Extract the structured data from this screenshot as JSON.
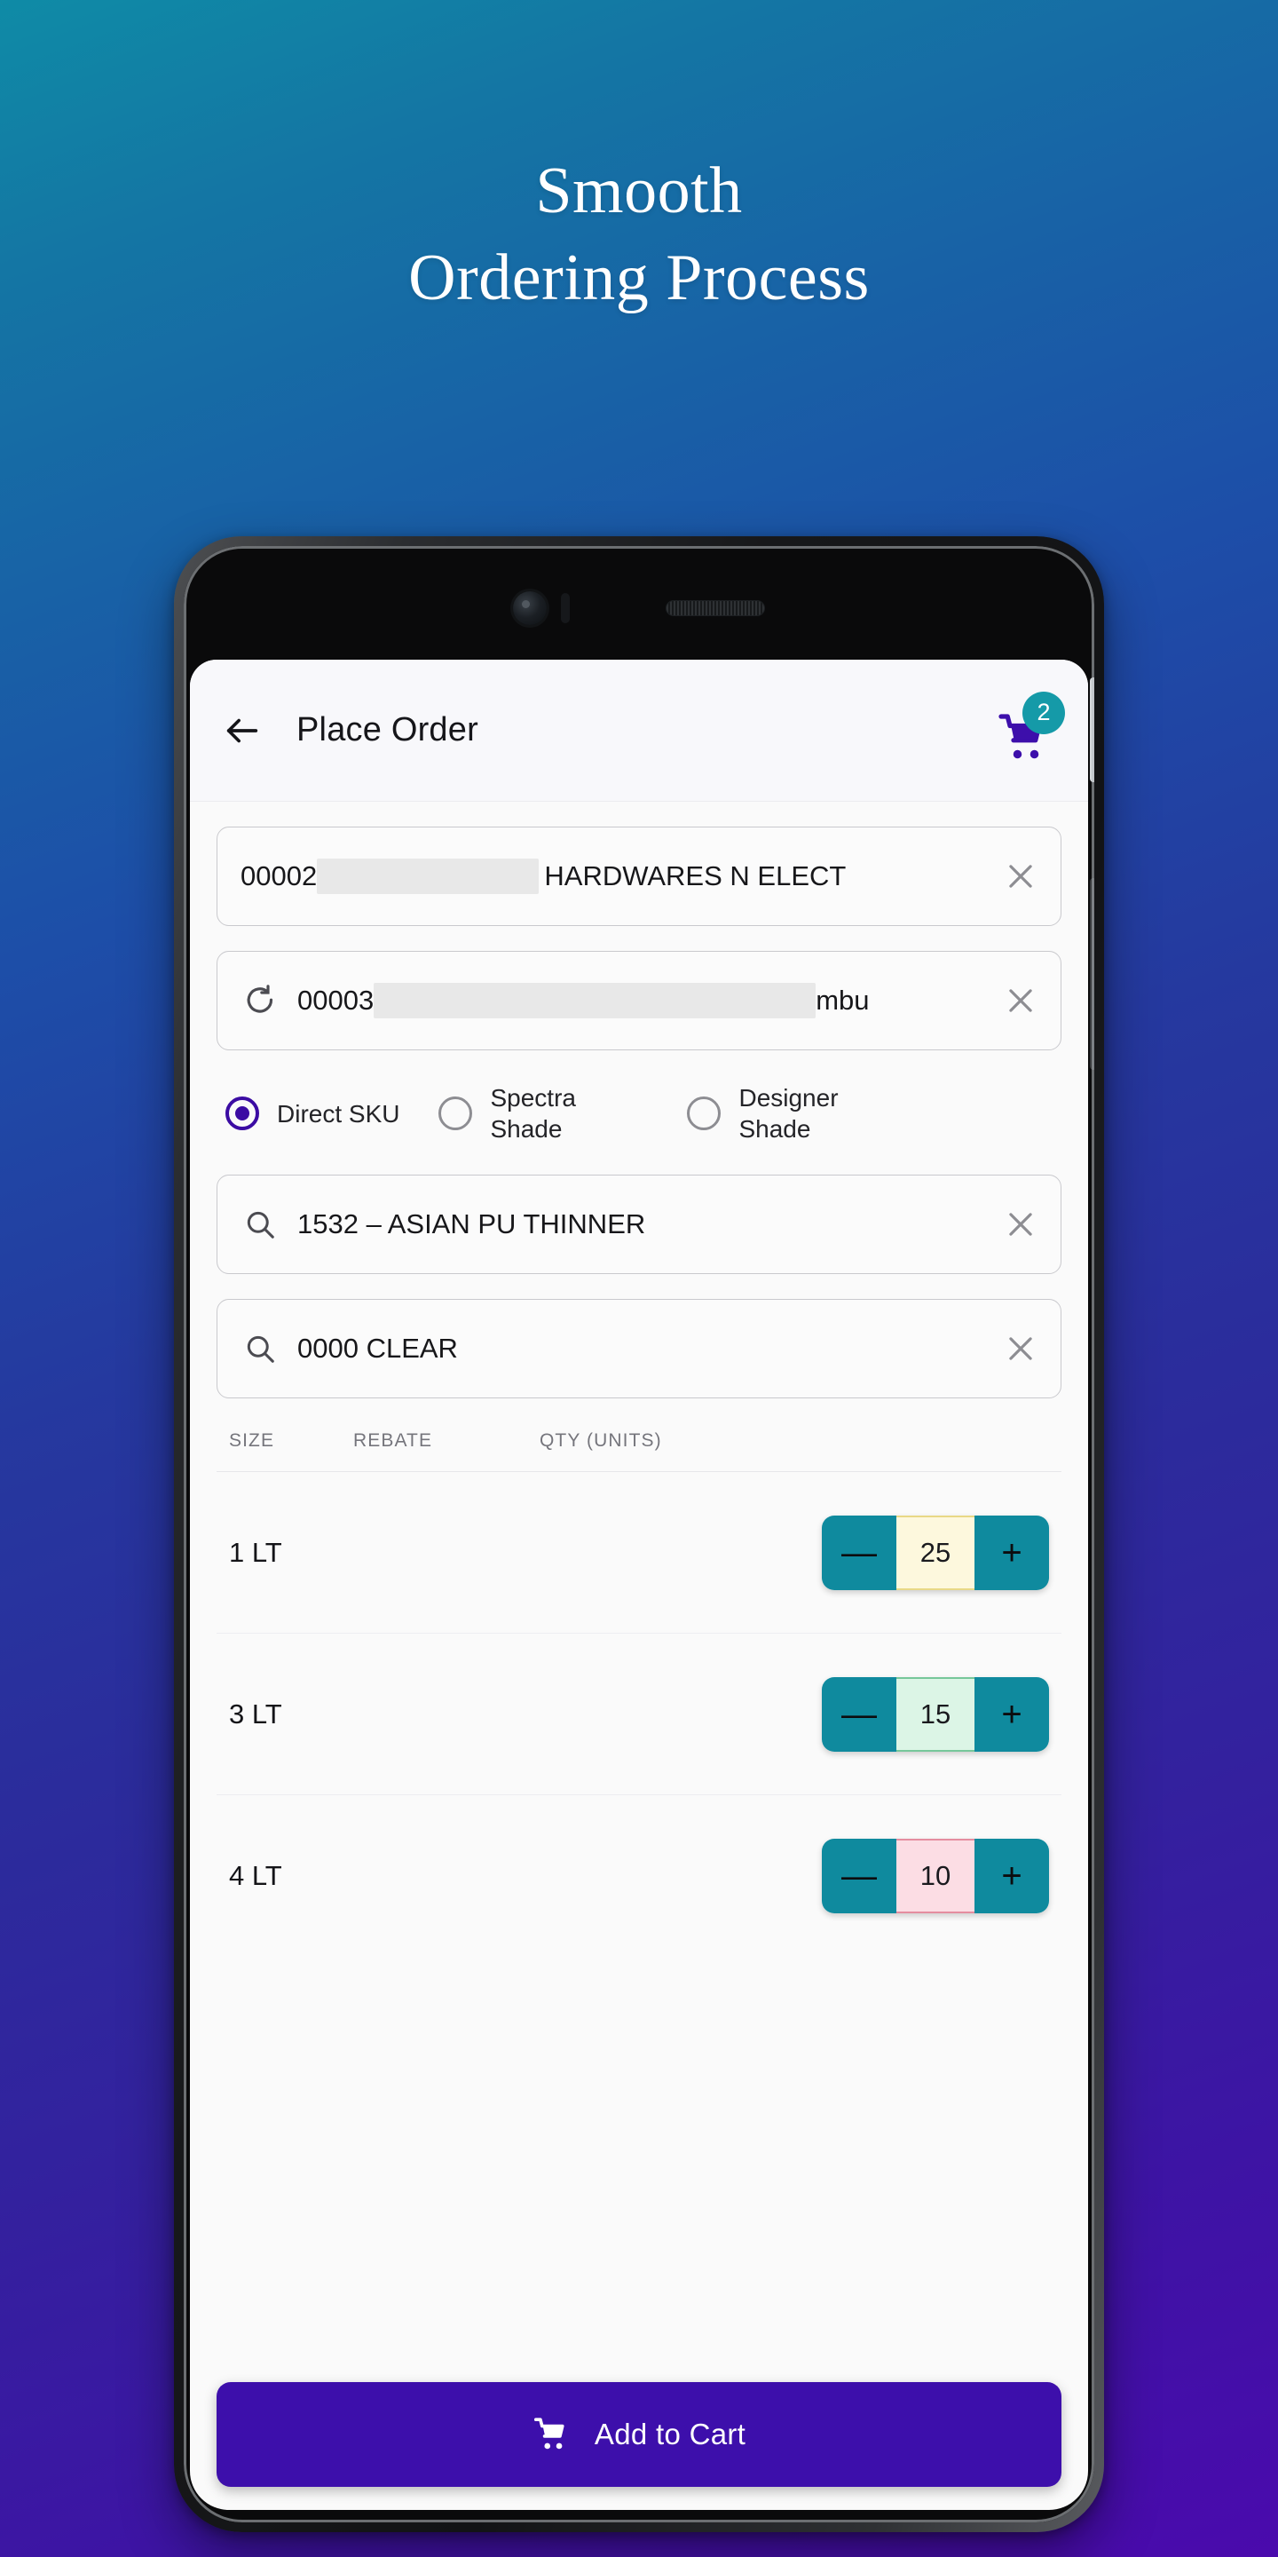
{
  "promo": {
    "headline_line1": "Smooth",
    "headline_line2": "Ordering Process",
    "bg_top_color": "#0f8ba6",
    "bg_bottom_color": "#4a0aad"
  },
  "appbar": {
    "back_icon": "back-arrow-icon",
    "title": "Place Order",
    "cart_icon": "shopping-cart-icon",
    "cart_badge_count": "2",
    "cart_badge_color": "#159aa8",
    "cart_icon_color": "#3d0fab"
  },
  "fields": {
    "customer": {
      "prefix": "00002",
      "redacted": true,
      "suffix": " HARDWARES N ELECT",
      "clear_icon": "close-icon"
    },
    "ship_to": {
      "refresh_icon": "refresh-icon",
      "prefix": "00003",
      "redacted": true,
      "suffix": "mbu",
      "clear_icon": "close-icon"
    },
    "product": {
      "search_icon": "search-icon",
      "value": "1532 – ASIAN PU THINNER",
      "clear_icon": "close-icon"
    },
    "shade": {
      "search_icon": "search-icon",
      "value": "0000 CLEAR",
      "clear_icon": "close-icon"
    }
  },
  "sku_type": {
    "options": [
      {
        "label": "Direct SKU",
        "selected": true
      },
      {
        "label": "Spectra Shade",
        "selected": false
      },
      {
        "label": "Designer Shade",
        "selected": false
      }
    ],
    "selected_color": "#3b0ca3"
  },
  "table": {
    "columns": [
      "SIZE",
      "REBATE",
      "QTY (UNITS)"
    ],
    "rows": [
      {
        "size": "1 LT",
        "rebate": "",
        "qty": "25",
        "qty_bg": "#fdf8dd",
        "qty_border": "#e8d886"
      },
      {
        "size": "3 LT",
        "rebate": "",
        "qty": "15",
        "qty_bg": "#dcf5e6",
        "qty_border": "#77c79a"
      },
      {
        "size": "4 LT",
        "rebate": "",
        "qty": "10",
        "qty_bg": "#fcdde4",
        "qty_border": "#e58ea0"
      }
    ],
    "stepper": {
      "minus_label": "—",
      "plus_label": "+",
      "button_color": "#0f8a9e"
    }
  },
  "cta": {
    "icon": "shopping-cart-icon",
    "label": "Add to Cart",
    "color": "#3d0fab"
  }
}
